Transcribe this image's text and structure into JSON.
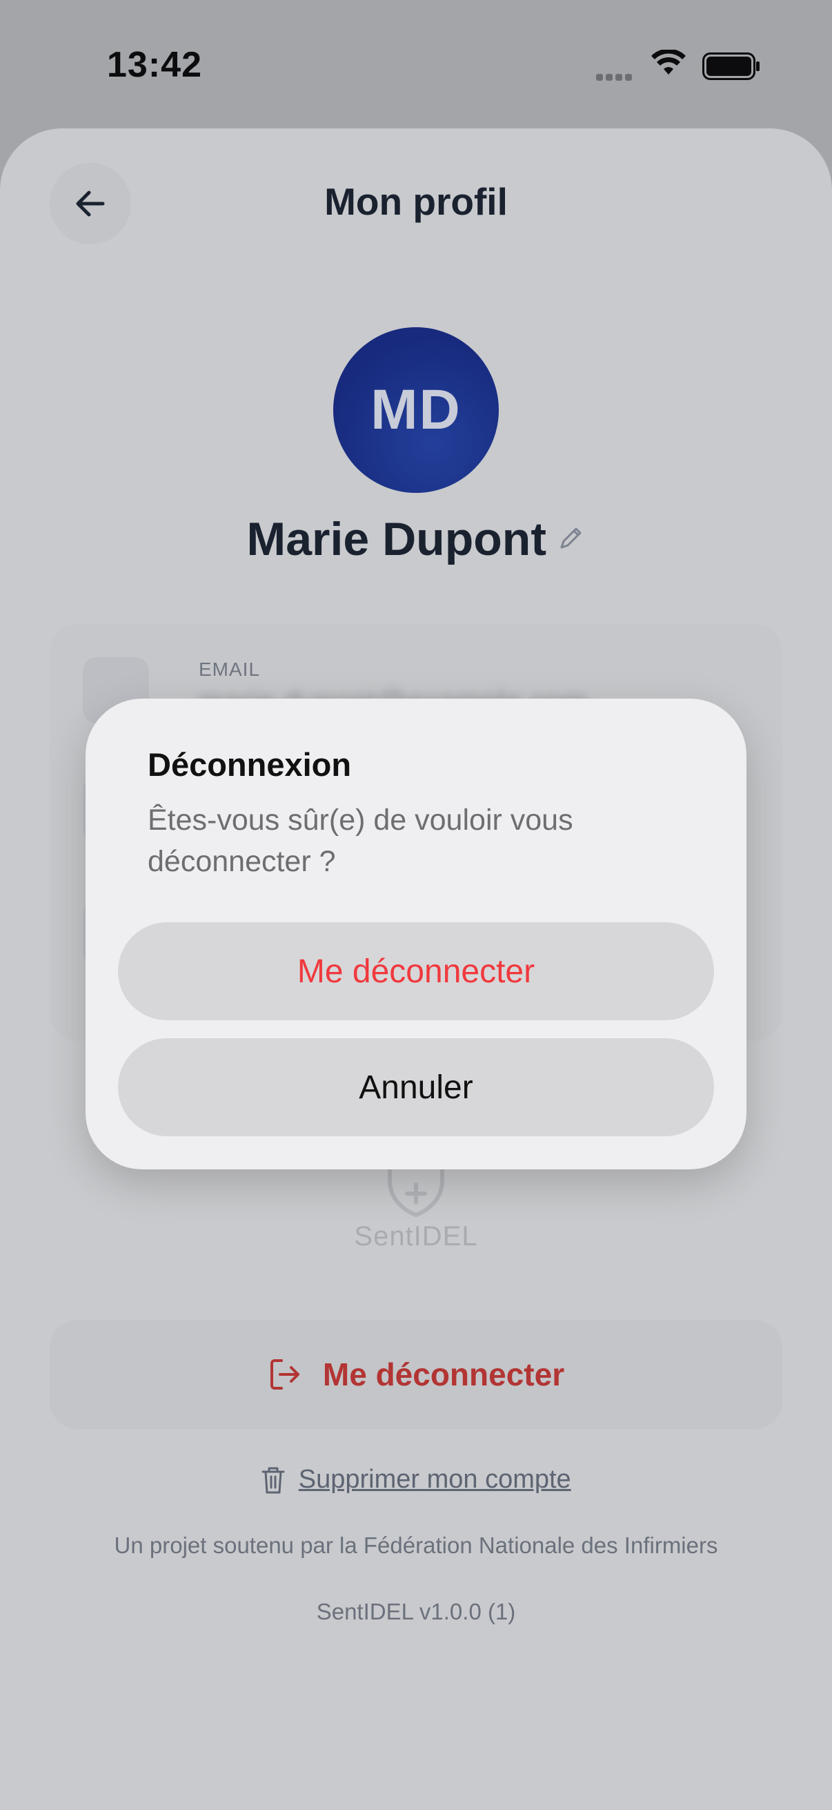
{
  "status_bar": {
    "time": "13:42"
  },
  "header": {
    "title": "Mon profil"
  },
  "profile": {
    "initials": "MD",
    "name": "Marie Dupont"
  },
  "info_card": {
    "rows": [
      {
        "label": "EMAIL",
        "value": "marie.dupont@example.com"
      },
      {
        "label": "",
        "value": ""
      },
      {
        "label": "",
        "value": ""
      }
    ]
  },
  "brand": {
    "name": "SentIDEL"
  },
  "actions": {
    "logout_label": "Me déconnecter",
    "delete_account_label": "Supprimer mon compte"
  },
  "footer": {
    "sponsor": "Un projet soutenu par la Fédération Nationale des Infirmiers",
    "version": "SentIDEL v1.0.0 (1)"
  },
  "alert": {
    "title": "Déconnexion",
    "message": "Êtes-vous sûr(e) de vouloir vous déconnecter ?",
    "confirm_label": "Me déconnecter",
    "cancel_label": "Annuler"
  },
  "colors": {
    "accent_navy": "#1a2f8a",
    "destructive_red": "#f0393d",
    "logout_red": "#b23534"
  }
}
